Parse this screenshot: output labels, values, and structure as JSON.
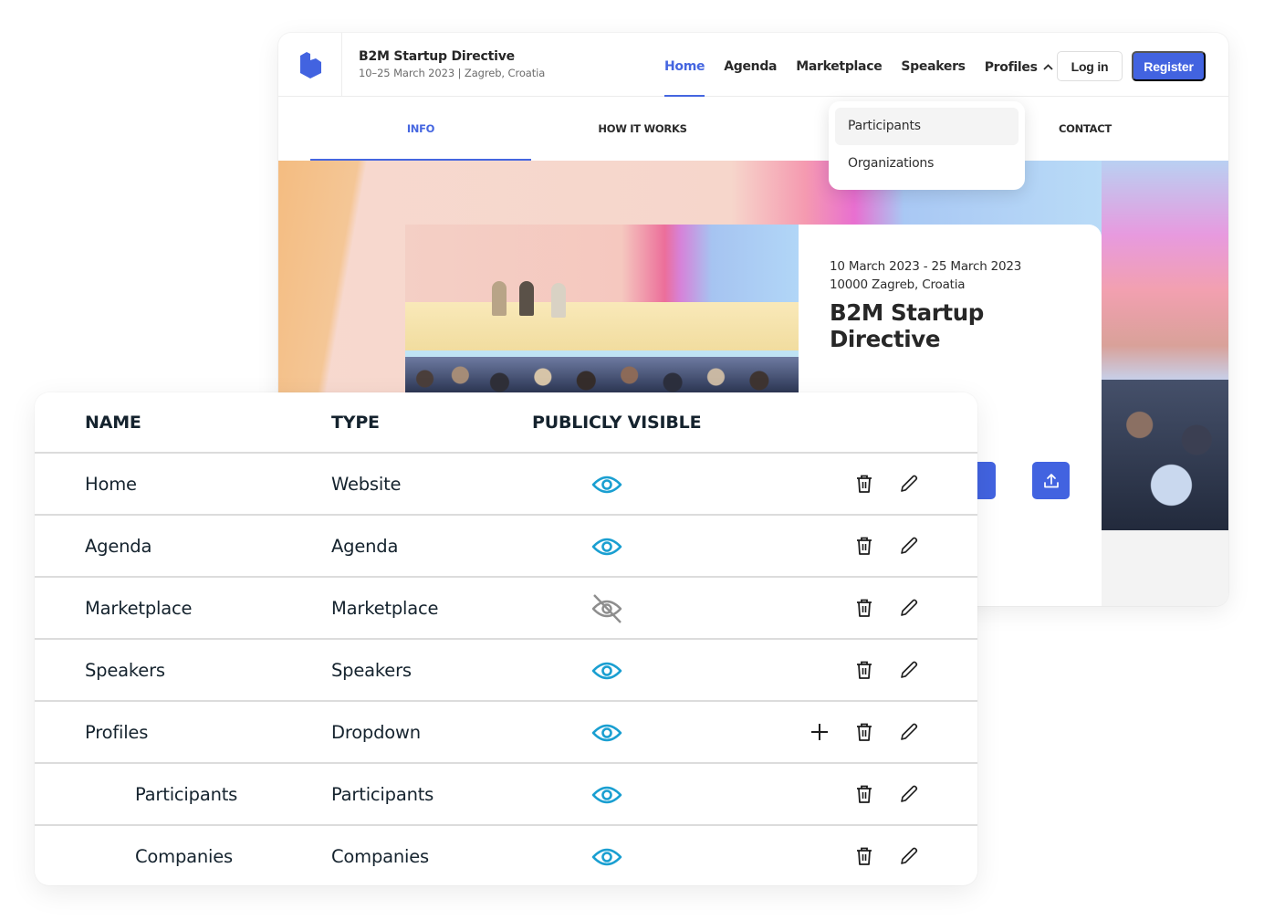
{
  "site": {
    "logo_icon": "hexagon-b-logo-icon",
    "brand_title": "B2M Startup Directive",
    "brand_subtitle": "10–25 March 2023 | Zagreb, Croatia",
    "nav": [
      {
        "label": "Home",
        "active": true
      },
      {
        "label": "Agenda"
      },
      {
        "label": "Marketplace"
      },
      {
        "label": "Speakers"
      },
      {
        "label": "Profiles",
        "icon": "chevron-up-icon"
      }
    ],
    "login_label": "Log in",
    "register_label": "Register",
    "subnav": [
      {
        "label": "INFO",
        "active": true
      },
      {
        "label": "HOW IT WORKS"
      },
      {
        "label": "CONTACT"
      }
    ],
    "dropdown": [
      {
        "label": "Participants",
        "hover": true
      },
      {
        "label": "Organizations"
      }
    ],
    "hero": {
      "dates": "10 March 2023 - 25 March 2023",
      "location": "10000 Zagreb, Croatia",
      "title": "B2M Startup Directive",
      "upload_icon": "upload-icon"
    },
    "colors": {
      "accent": "#4263e0",
      "nav_active": "#4566e0"
    }
  },
  "table": {
    "headers": {
      "name": "NAME",
      "type": "TYPE",
      "visible": "PUBLICLY VISIBLE"
    },
    "rows": [
      {
        "name": "Home",
        "type": "Website",
        "visible": true,
        "child": false,
        "can_add": false
      },
      {
        "name": "Agenda",
        "type": "Agenda",
        "visible": true,
        "child": false,
        "can_add": false
      },
      {
        "name": "Marketplace",
        "type": "Marketplace",
        "visible": false,
        "child": false,
        "can_add": false
      },
      {
        "name": "Speakers",
        "type": "Speakers",
        "visible": true,
        "child": false,
        "can_add": false
      },
      {
        "name": "Profiles",
        "type": "Dropdown",
        "visible": true,
        "child": false,
        "can_add": true
      },
      {
        "name": "Participants",
        "type": "Participants",
        "visible": true,
        "child": true,
        "can_add": false
      },
      {
        "name": "Companies",
        "type": "Companies",
        "visible": true,
        "child": true,
        "can_add": false
      }
    ],
    "colors": {
      "visible_icon": "#1a9fd1",
      "hidden_icon": "#8e8e8e",
      "text": "#15232e"
    }
  }
}
